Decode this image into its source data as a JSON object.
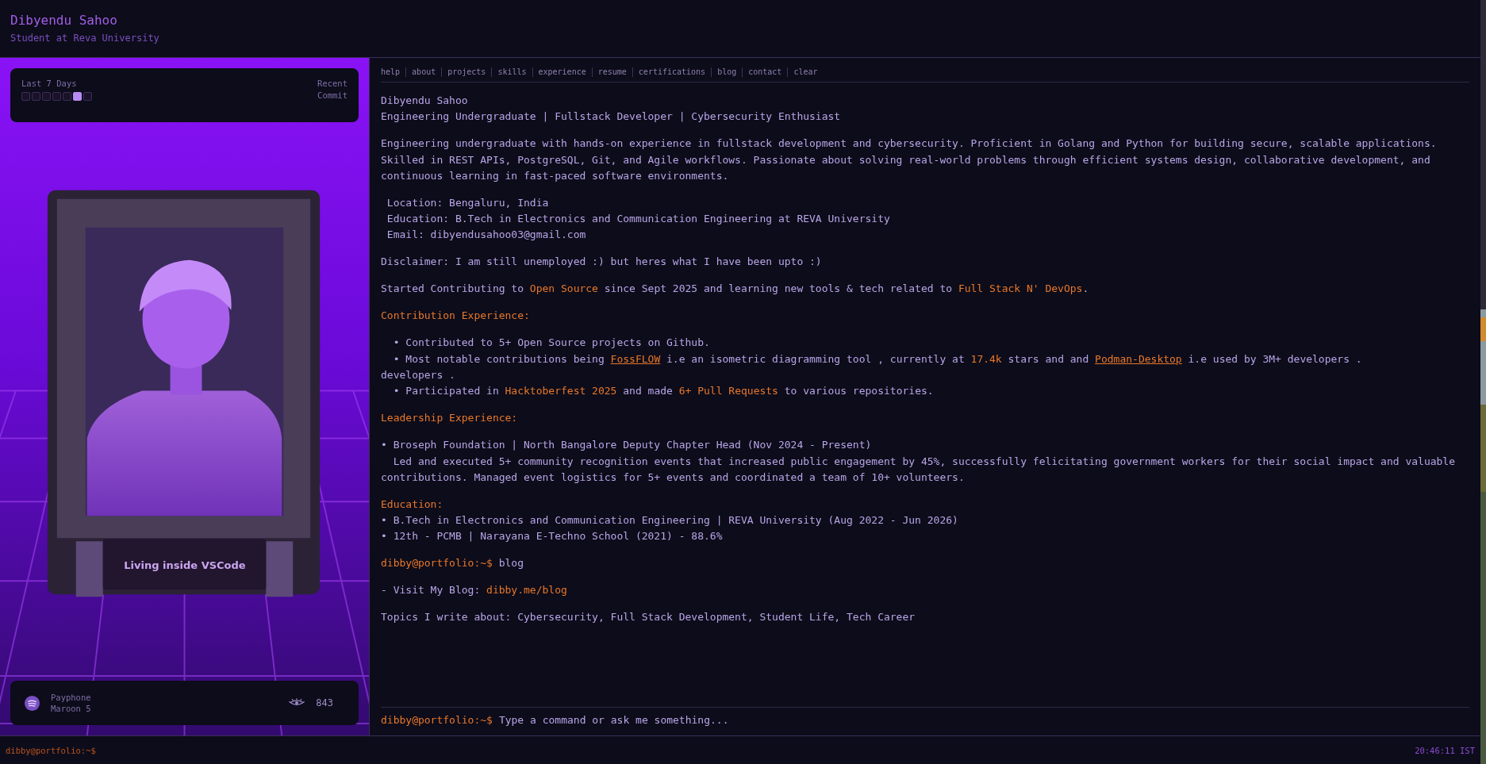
{
  "header": {
    "name": "Dibyendu Sahoo",
    "subtitle": "Student at Reva University"
  },
  "activity": {
    "label": "Last 7 Days",
    "days": [
      {
        "active": false
      },
      {
        "active": false
      },
      {
        "active": false
      },
      {
        "active": false
      },
      {
        "active": false
      },
      {
        "active": true
      },
      {
        "active": false
      }
    ],
    "recent_label": "Recent",
    "recent_value": "Commit"
  },
  "portrait": {
    "caption": "Living inside VSCode"
  },
  "now_playing": {
    "song": "Payphone",
    "artist": "Maroon 5",
    "views": "843"
  },
  "nav": [
    {
      "label": "help"
    },
    {
      "label": "about"
    },
    {
      "label": "projects"
    },
    {
      "label": "skills"
    },
    {
      "label": "experience"
    },
    {
      "label": "resume"
    },
    {
      "label": "certifications"
    },
    {
      "label": "blog"
    },
    {
      "label": "contact"
    },
    {
      "label": "clear"
    }
  ],
  "output": [
    {
      "lines": [
        [
          {
            "kind": "text",
            "text": "Dibyendu Sahoo"
          }
        ],
        [
          {
            "kind": "text",
            "text": "Engineering Undergraduate | Fullstack Developer | Cybersecurity Enthusiast"
          }
        ]
      ]
    },
    {
      "lines": [
        [
          {
            "kind": "text",
            "text": "Engineering undergraduate with hands-on experience in fullstack development and cybersecurity. Proficient in Golang and Python for building secure, scalable applications. Skilled in REST APIs, PostgreSQL, Git, and Agile workflows. Passionate about solving real-world problems through efficient systems design, collaborative development, and continuous learning in fast-paced software environments."
          }
        ]
      ]
    },
    {
      "lines": [
        [
          {
            "kind": "text",
            "text": " Location: Bengaluru, India"
          }
        ],
        [
          {
            "kind": "text",
            "text": " Education: B.Tech in Electronics and Communication Engineering at REVA University"
          }
        ],
        [
          {
            "kind": "text",
            "text": " Email: dibyendusahoo03@gmail.com"
          }
        ]
      ]
    },
    {
      "lines": [
        [
          {
            "kind": "text",
            "text": "Disclaimer: I am still unemployed :) but heres what I have been upto :)"
          }
        ]
      ]
    },
    {
      "lines": [
        [
          {
            "kind": "text",
            "text": "Started Contributing to "
          },
          {
            "kind": "accent",
            "text": "Open Source"
          },
          {
            "kind": "text",
            "text": " since Sept 2025 and learning new tools & tech related to "
          },
          {
            "kind": "accent",
            "text": "Full Stack N' DevOps"
          },
          {
            "kind": "text",
            "text": "."
          }
        ]
      ]
    },
    {
      "lines": [
        [
          {
            "kind": "accent",
            "text": "Contribution Experience:"
          }
        ]
      ]
    },
    {
      "lines": [
        [
          {
            "kind": "text",
            "text": "  • Contributed to 5+ Open Source projects on Github."
          }
        ],
        [
          {
            "kind": "text",
            "text": "  • Most notable contributions being "
          },
          {
            "kind": "link",
            "text": "FossFLOW"
          },
          {
            "kind": "text",
            "text": " i.e an isometric diagramming tool , currently at "
          },
          {
            "kind": "accent",
            "text": "17.4k"
          },
          {
            "kind": "text",
            "text": " stars and and "
          },
          {
            "kind": "link",
            "text": "Podman-Desktop"
          },
          {
            "kind": "text",
            "text": " i.e used by 3M+ developers ."
          }
        ],
        [
          {
            "kind": "text",
            "text": "developers ."
          }
        ],
        [
          {
            "kind": "text",
            "text": "  • Participated in "
          },
          {
            "kind": "accent",
            "text": "Hacktoberfest 2025"
          },
          {
            "kind": "text",
            "text": " and made "
          },
          {
            "kind": "accent",
            "text": "6+ Pull Requests"
          },
          {
            "kind": "text",
            "text": " to various repositories."
          }
        ]
      ]
    },
    {
      "lines": [
        [
          {
            "kind": "accent",
            "text": "Leadership Experience:"
          }
        ]
      ]
    },
    {
      "lines": [
        [
          {
            "kind": "text",
            "text": "• Broseph Foundation | North Bangalore Deputy Chapter Head (Nov 2024 - Present)"
          }
        ],
        [
          {
            "kind": "text",
            "text": "  Led and executed 5+ community recognition events that increased public engagement by 45%, successfully felicitating government workers for their social impact and valuable contributions. Managed event logistics for 5+ events and coordinated a team of 10+ volunteers."
          }
        ]
      ]
    },
    {
      "lines": [
        [
          {
            "kind": "accent",
            "text": "Education:"
          }
        ],
        [
          {
            "kind": "text",
            "text": "• B.Tech in Electronics and Communication Engineering | REVA University (Aug 2022 - Jun 2026)"
          }
        ],
        [
          {
            "kind": "text",
            "text": "• 12th - PCMB | Narayana E-Techno School (2021) - 88.6%"
          }
        ]
      ]
    },
    {
      "lines": [
        [
          {
            "kind": "accent",
            "text": "dibby@portfolio:~$"
          },
          {
            "kind": "text",
            "text": " blog"
          }
        ]
      ]
    },
    {
      "lines": [
        [
          {
            "kind": "text",
            "text": "- Visit My Blog: "
          },
          {
            "kind": "accent",
            "text": "dibby.me/blog"
          }
        ]
      ]
    },
    {
      "lines": [
        [
          {
            "kind": "text",
            "text": "Topics I write about: Cybersecurity, Full Stack Development, Student Life, Tech Career"
          }
        ]
      ]
    }
  ],
  "prompt": {
    "prefix": "dibby@portfolio:~$",
    "placeholder": "Type a command or ask me something..."
  },
  "status_bar": {
    "prompt": "dibby@portfolio:~$",
    "time": "20:46:11 IST"
  }
}
